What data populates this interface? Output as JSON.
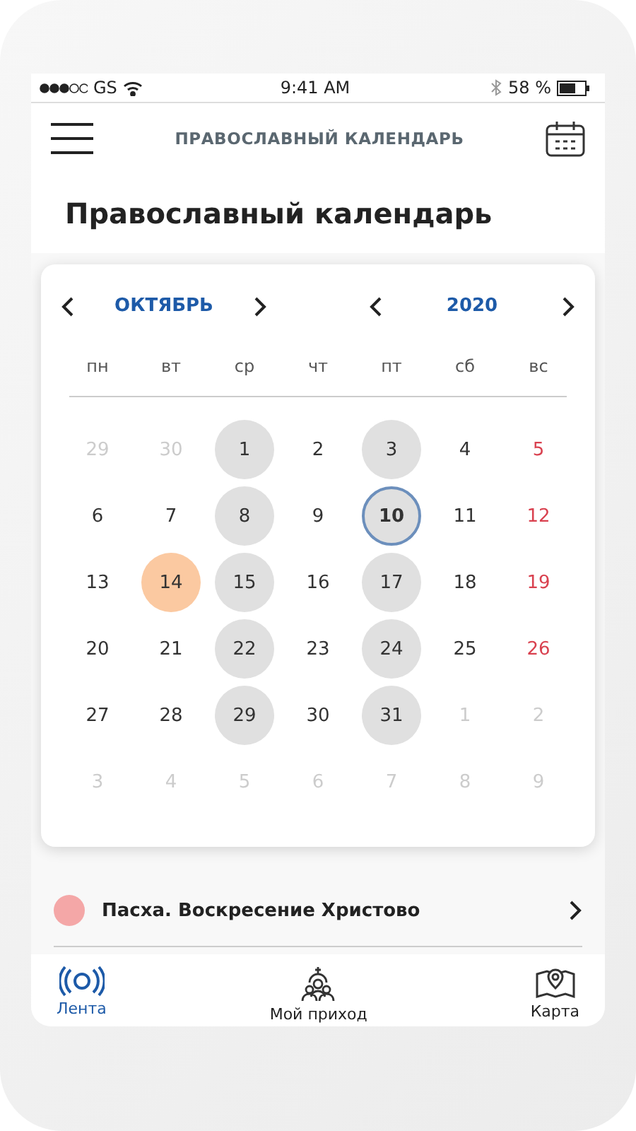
{
  "status_bar": {
    "carrier": "GS",
    "time": "9:41 AM",
    "battery": "58 %"
  },
  "header": {
    "title": "ПРАВОСЛАВНЫЙ КАЛЕНДАРЬ"
  },
  "page_title": "Православный календарь",
  "calendar": {
    "month": "ОКТЯБРЬ",
    "year": "2020",
    "weekdays": [
      "пн",
      "вт",
      "ср",
      "чт",
      "пт",
      "сб",
      "вс"
    ],
    "weeks": [
      [
        {
          "day": "29",
          "kind": "outside",
          "fast": false,
          "today": false,
          "selected": false
        },
        {
          "day": "30",
          "kind": "outside",
          "fast": false,
          "today": false,
          "selected": false
        },
        {
          "day": "1",
          "kind": "weekday",
          "fast": true,
          "today": false,
          "selected": false
        },
        {
          "day": "2",
          "kind": "weekday",
          "fast": false,
          "today": false,
          "selected": false
        },
        {
          "day": "3",
          "kind": "weekday",
          "fast": true,
          "today": false,
          "selected": false
        },
        {
          "day": "4",
          "kind": "weekday",
          "fast": false,
          "today": false,
          "selected": false
        },
        {
          "day": "5",
          "kind": "sunday",
          "fast": false,
          "today": false,
          "selected": false
        }
      ],
      [
        {
          "day": "6",
          "kind": "weekday",
          "fast": false,
          "today": false,
          "selected": false
        },
        {
          "day": "7",
          "kind": "weekday",
          "fast": false,
          "today": false,
          "selected": false
        },
        {
          "day": "8",
          "kind": "weekday",
          "fast": true,
          "today": false,
          "selected": false
        },
        {
          "day": "9",
          "kind": "weekday",
          "fast": false,
          "today": false,
          "selected": false
        },
        {
          "day": "10",
          "kind": "weekday",
          "fast": true,
          "today": true,
          "selected": false
        },
        {
          "day": "11",
          "kind": "weekday",
          "fast": false,
          "today": false,
          "selected": false
        },
        {
          "day": "12",
          "kind": "sunday",
          "fast": false,
          "today": false,
          "selected": false
        }
      ],
      [
        {
          "day": "13",
          "kind": "weekday",
          "fast": false,
          "today": false,
          "selected": false
        },
        {
          "day": "14",
          "kind": "weekday",
          "fast": false,
          "today": false,
          "selected": true
        },
        {
          "day": "15",
          "kind": "weekday",
          "fast": true,
          "today": false,
          "selected": false
        },
        {
          "day": "16",
          "kind": "weekday",
          "fast": false,
          "today": false,
          "selected": false
        },
        {
          "day": "17",
          "kind": "weekday",
          "fast": true,
          "today": false,
          "selected": false
        },
        {
          "day": "18",
          "kind": "weekday",
          "fast": false,
          "today": false,
          "selected": false
        },
        {
          "day": "19",
          "kind": "sunday",
          "fast": false,
          "today": false,
          "selected": false
        }
      ],
      [
        {
          "day": "20",
          "kind": "weekday",
          "fast": false,
          "today": false,
          "selected": false
        },
        {
          "day": "21",
          "kind": "weekday",
          "fast": false,
          "today": false,
          "selected": false
        },
        {
          "day": "22",
          "kind": "weekday",
          "fast": true,
          "today": false,
          "selected": false
        },
        {
          "day": "23",
          "kind": "weekday",
          "fast": false,
          "today": false,
          "selected": false
        },
        {
          "day": "24",
          "kind": "weekday",
          "fast": true,
          "today": false,
          "selected": false
        },
        {
          "day": "25",
          "kind": "weekday",
          "fast": false,
          "today": false,
          "selected": false
        },
        {
          "day": "26",
          "kind": "sunday",
          "fast": false,
          "today": false,
          "selected": false
        }
      ],
      [
        {
          "day": "27",
          "kind": "weekday",
          "fast": false,
          "today": false,
          "selected": false
        },
        {
          "day": "28",
          "kind": "weekday",
          "fast": false,
          "today": false,
          "selected": false
        },
        {
          "day": "29",
          "kind": "weekday",
          "fast": true,
          "today": false,
          "selected": false
        },
        {
          "day": "30",
          "kind": "weekday",
          "fast": false,
          "today": false,
          "selected": false
        },
        {
          "day": "31",
          "kind": "weekday",
          "fast": true,
          "today": false,
          "selected": false
        },
        {
          "day": "1",
          "kind": "outside",
          "fast": false,
          "today": false,
          "selected": false
        },
        {
          "day": "2",
          "kind": "outside",
          "fast": false,
          "today": false,
          "selected": false
        }
      ],
      [
        {
          "day": "3",
          "kind": "outside",
          "fast": false,
          "today": false,
          "selected": false
        },
        {
          "day": "4",
          "kind": "outside",
          "fast": false,
          "today": false,
          "selected": false
        },
        {
          "day": "5",
          "kind": "outside",
          "fast": false,
          "today": false,
          "selected": false
        },
        {
          "day": "6",
          "kind": "outside",
          "fast": false,
          "today": false,
          "selected": false
        },
        {
          "day": "7",
          "kind": "outside",
          "fast": false,
          "today": false,
          "selected": false
        },
        {
          "day": "8",
          "kind": "outside",
          "fast": false,
          "today": false,
          "selected": false
        },
        {
          "day": "9",
          "kind": "outside",
          "fast": false,
          "today": false,
          "selected": false
        }
      ]
    ]
  },
  "events": [
    {
      "title": "Пасха. Воскресение Христово",
      "color": "#f4a7a7"
    }
  ],
  "tab_bar": [
    {
      "label": "Лента",
      "kind": "feed",
      "selected": true
    },
    {
      "label": "Мой приход",
      "kind": "parish",
      "selected": false
    },
    {
      "label": "Карта",
      "kind": "map",
      "selected": false
    }
  ]
}
